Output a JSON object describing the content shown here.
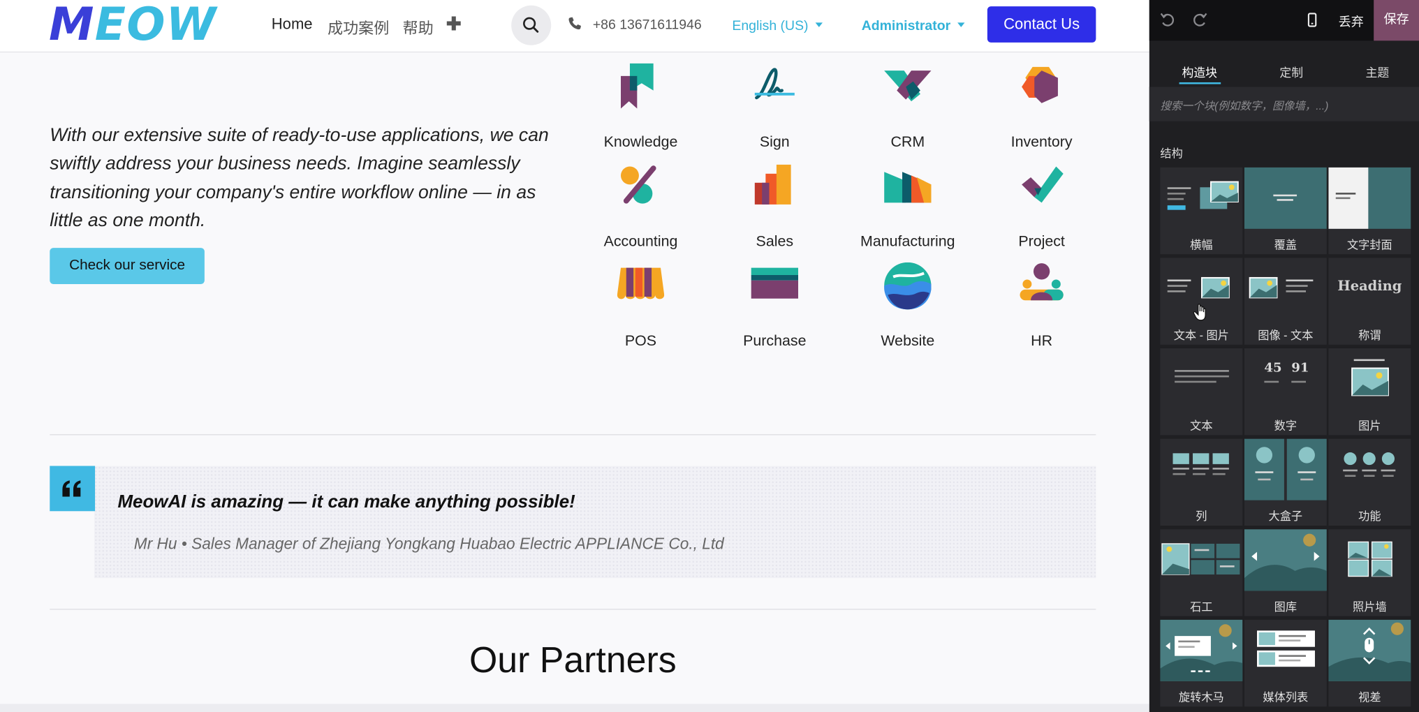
{
  "navbar": {
    "logo_m": "M",
    "logo_rest": "EOW",
    "links": [
      "Home",
      "成功案例",
      "帮助"
    ],
    "phone": "+86 13671611946",
    "language": "English (US)",
    "user": "Administrator",
    "contact_label": "Contact Us"
  },
  "intro": {
    "text": "With our extensive suite of ready-to-use applications, we can swiftly address your business needs. Imagine seamlessly transitioning your company's entire workflow online — in as little as one month.",
    "button_label": "Check our service"
  },
  "apps": [
    {
      "label": "Knowledge",
      "icon": "knowledge-icon"
    },
    {
      "label": "Sign",
      "icon": "sign-icon"
    },
    {
      "label": "CRM",
      "icon": "crm-icon"
    },
    {
      "label": "Inventory",
      "icon": "inventory-icon"
    },
    {
      "label": "Accounting",
      "icon": "accounting-icon"
    },
    {
      "label": "Sales",
      "icon": "sales-icon"
    },
    {
      "label": "Manufacturing",
      "icon": "manufacturing-icon"
    },
    {
      "label": "Project",
      "icon": "project-icon"
    },
    {
      "label": "POS",
      "icon": "pos-icon"
    },
    {
      "label": "Purchase",
      "icon": "purchase-icon"
    },
    {
      "label": "Website",
      "icon": "website-icon"
    },
    {
      "label": "HR",
      "icon": "hr-icon"
    }
  ],
  "quote": {
    "text": "MeowAI is amazing — it can make anything possible!",
    "author": "Mr Hu • Sales Manager of Zhejiang Yongkang Huabao Electric APPLIANCE Co., Ltd"
  },
  "partners_title": "Our Partners",
  "editor": {
    "discard_label": "丢弃",
    "save_label": "保存",
    "tabs": [
      "构造块",
      "定制",
      "主题"
    ],
    "search_placeholder": "搜索一个块(例如数字，图像墙，...)",
    "section_title": "结构",
    "blocks": [
      "横幅",
      "覆盖",
      "文字封面",
      "文本 - 图片",
      "图像 - 文本",
      "称谓",
      "文本",
      "数字",
      "图片",
      "列",
      "大盒子",
      "功能",
      "石工",
      "图库",
      "照片墙",
      "旋转木马",
      "媒体列表",
      "视差"
    ],
    "thumb_heading": "Heading",
    "thumb_numbers": [
      "45",
      "91"
    ]
  },
  "colors": {
    "brand_blue": "#2e2ee8",
    "accent_cyan": "#40b9e3",
    "save_purple": "#7b4a68"
  }
}
